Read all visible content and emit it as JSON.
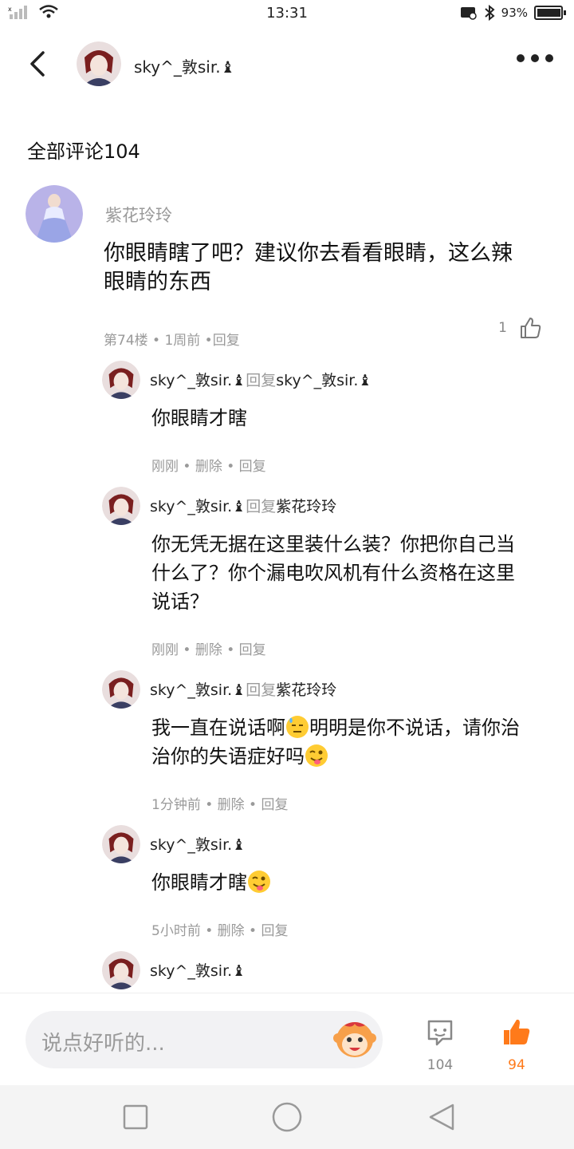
{
  "status_bar": {
    "time": "13:31",
    "battery_percent_text": "93%",
    "battery_level": 0.93
  },
  "header": {
    "username": "sky^_敦sir.♝"
  },
  "section": {
    "title": "全部评论104"
  },
  "main_comment": {
    "author": "紫花玲玲",
    "text": "你眼睛瞎了吧？建议你去看看眼睛，这么辣眼睛的东西",
    "meta": "第74楼 • 1周前 •回复",
    "like_count": "1"
  },
  "replies": [
    {
      "author": "sky^_敦sir.♝",
      "reply_word": "回复",
      "target": "sky^_敦sir.♝",
      "text": "你眼睛才瞎",
      "meta": "刚刚 • 删除 • 回复"
    },
    {
      "author": "sky^_敦sir.♝",
      "reply_word": "回复",
      "target": "紫花玲玲",
      "text": "你无凭无据在这里装什么装？你把你自己当什么了？你个漏电吹风机有什么资格在这里说话？",
      "meta": "刚刚 • 删除 • 回复"
    },
    {
      "author": "sky^_敦sir.♝",
      "reply_word": "回复",
      "target": "紫花玲玲",
      "text_a": "我一直在说话啊",
      "text_b": "明明是你不说话，请你治治你的失语症好吗",
      "meta": "1分钟前 • 删除 • 回复"
    },
    {
      "author": "sky^_敦sir.♝",
      "text": "你眼睛才瞎",
      "meta": "5小时前 • 删除 • 回复"
    },
    {
      "author": "sky^_敦sir.♝"
    }
  ],
  "bottom_bar": {
    "input_placeholder": "说点好听的...",
    "comment_count": "104",
    "like_count": "94"
  },
  "colors": {
    "accent": "#ff7a1a",
    "muted": "#9a9a9a"
  },
  "icons": [
    "back-icon",
    "more-icon",
    "thumbs-up-icon",
    "comment-icon",
    "monkey-emoji-icon",
    "sweat-emoji-icon",
    "wink-tongue-emoji-icon"
  ]
}
